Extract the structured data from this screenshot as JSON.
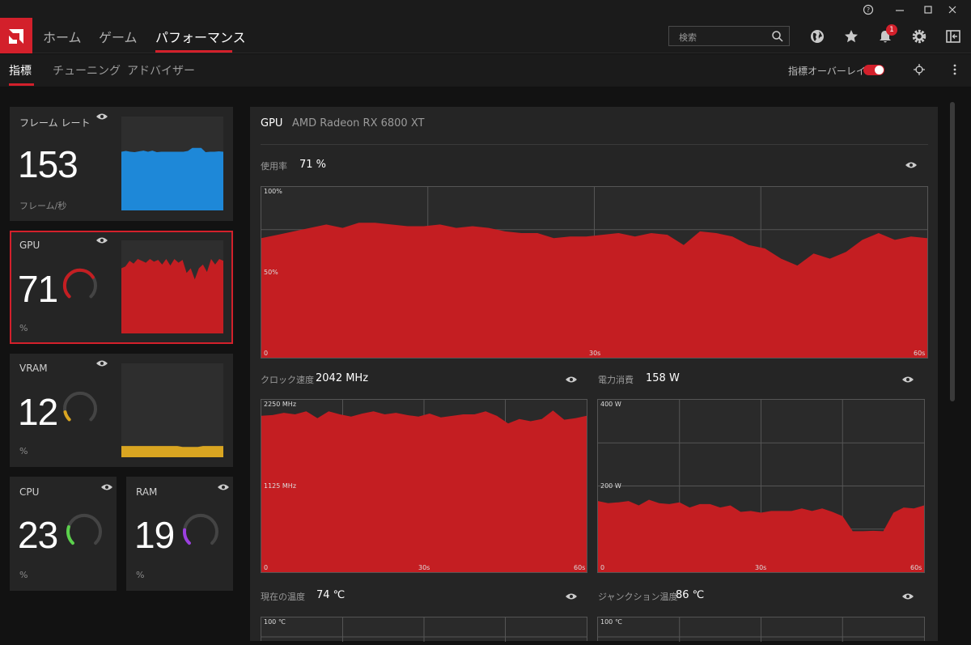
{
  "nav": {
    "tabs": [
      {
        "label": "ホーム"
      },
      {
        "label": "ゲーム"
      },
      {
        "label": "パフォーマンス"
      }
    ]
  },
  "search": {
    "placeholder": "検索"
  },
  "notifications": {
    "count": "1"
  },
  "subnav": {
    "tabs": [
      {
        "label": "指標"
      },
      {
        "label": "チューニング"
      },
      {
        "label": "アドバイザー"
      }
    ],
    "overlay_label": "指標オーバーレイ",
    "overlay_on": true
  },
  "cards": {
    "framerate": {
      "label": "フレーム レート",
      "value": "153",
      "unit": "フレーム/秒",
      "color": "#1e88d8"
    },
    "gpu": {
      "label": "GPU",
      "value": "71",
      "unit": "%",
      "color": "#c41e22",
      "gauge": 0.71
    },
    "vram": {
      "label": "VRAM",
      "value": "12",
      "unit": "%",
      "color": "#d9a521",
      "gauge": 0.12
    },
    "cpu": {
      "label": "CPU",
      "value": "23",
      "unit": "%",
      "color": "#5bd14c",
      "gauge": 0.23
    },
    "ram": {
      "label": "RAM",
      "value": "19",
      "unit": "%",
      "color": "#9b3fe0",
      "gauge": 0.19
    }
  },
  "panel": {
    "title": "GPU",
    "device": "AMD Radeon RX 6800 XT",
    "usage": {
      "label": "使用率",
      "value": "71 %",
      "y_top": "100%",
      "y_mid": "50%",
      "x0": "0",
      "x_mid": "30s",
      "x_end": "60s"
    },
    "clock": {
      "label": "クロック速度",
      "value": "2042 MHz",
      "y_top": "2250 MHz",
      "y_mid": "1125 MHz",
      "x0": "0",
      "x_mid": "30s",
      "x_end": "60s"
    },
    "power": {
      "label": "電力消費",
      "value": "158 W",
      "y_top": "400 W",
      "y_mid": "200 W",
      "x0": "0",
      "x_mid": "30s",
      "x_end": "60s"
    },
    "temp": {
      "label": "現在の温度",
      "value": "74 ℃",
      "y_top": "100 ℃"
    },
    "junction": {
      "label": "ジャンクション温度",
      "value": "86 ℃",
      "y_top": "100 ℃"
    }
  },
  "series": {
    "framerate": [
      150,
      152,
      150,
      149,
      151,
      153,
      150,
      153,
      149,
      150,
      150,
      150,
      150,
      150,
      150,
      152,
      160,
      160,
      160,
      149,
      150,
      150,
      151,
      150
    ],
    "gpu": [
      70,
      72,
      78,
      75,
      80,
      78,
      76,
      80,
      77,
      79,
      74,
      80,
      73,
      80,
      76,
      79,
      65,
      70,
      58,
      70,
      74,
      66,
      80,
      74,
      80,
      78
    ],
    "vram": [
      12,
      12,
      12,
      12,
      12,
      12,
      12,
      12,
      12,
      12,
      12,
      12,
      11,
      11,
      11,
      11,
      12,
      12,
      12,
      12,
      12
    ],
    "usage": [
      70,
      72,
      74,
      76,
      78,
      76,
      79,
      79,
      78,
      77,
      77,
      78,
      76,
      77,
      76,
      74,
      73,
      73,
      70,
      71,
      71,
      72,
      73,
      71,
      73,
      72,
      66,
      74,
      73,
      71,
      66,
      64,
      58,
      54,
      61,
      58,
      62,
      69,
      73,
      69,
      71,
      70
    ],
    "clock": [
      2042,
      2050,
      2080,
      2060,
      2100,
      2010,
      2100,
      2060,
      2030,
      2070,
      2100,
      2060,
      2080,
      2050,
      2030,
      2070,
      2020,
      2040,
      2060,
      2060,
      2100,
      2040,
      1940,
      2000,
      1970,
      2000,
      2110,
      1990,
      2010,
      2042
    ],
    "power": [
      165,
      160,
      162,
      165,
      155,
      168,
      160,
      158,
      162,
      150,
      158,
      158,
      150,
      155,
      140,
      142,
      138,
      142,
      142,
      142,
      148,
      142,
      148,
      140,
      130,
      95,
      95,
      96,
      95,
      138,
      150,
      148,
      155
    ]
  }
}
